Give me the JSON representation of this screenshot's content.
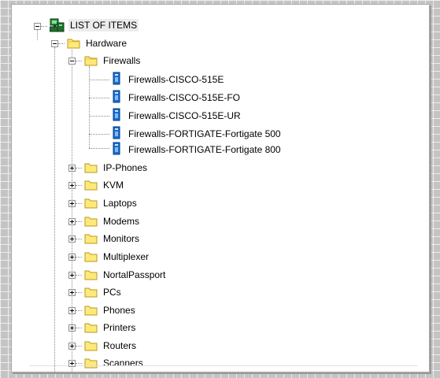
{
  "tree": {
    "root": {
      "label": "LIST OF ITEMS"
    },
    "hardware": {
      "label": "Hardware"
    },
    "firewalls": {
      "label": "Firewalls",
      "children": [
        "Firewalls-CISCO-515E",
        "Firewalls-CISCO-515E-FO",
        "Firewalls-CISCO-515E-UR",
        "Firewalls-FORTIGATE-Fortigate 500",
        "Firewalls-FORTIGATE-Fortigate 800"
      ]
    },
    "folders": [
      "IP-Phones",
      "KVM",
      "Laptops",
      "Modems",
      "Monitors",
      "Multiplexer",
      "NortalPassport",
      "PCs",
      "Phones",
      "Printers",
      "Routers",
      "Scanners"
    ]
  },
  "colors": {
    "folder_fill": "#ffe97a",
    "folder_stroke": "#b89a1c",
    "device_fill": "#1a6fd1",
    "root_fill": "#2a8a3a"
  }
}
